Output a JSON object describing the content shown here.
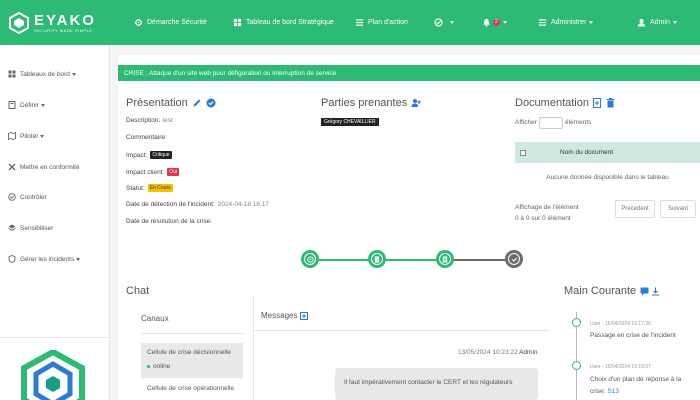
{
  "brand": {
    "name": "EYAKO",
    "tagline": "SECURITY MADE SIMPLE",
    "accent": "#2dba74"
  },
  "topnav": {
    "items": [
      {
        "id": "demarche",
        "label": "Démarche Sécurité",
        "icon": "gear-icon"
      },
      {
        "id": "tableau",
        "label": "Tableau de bord Stratégique",
        "icon": "grid-icon"
      },
      {
        "id": "plan",
        "label": "Plan d'action",
        "icon": "list-icon"
      }
    ],
    "check_icon": "check-circle-icon",
    "notifications_count": "2",
    "admin_menu": "Administrer",
    "user_menu": "Admin"
  },
  "sidebar": {
    "items": [
      {
        "label": "Tableaux de bord",
        "icon": "dashboard-icon",
        "dropdown": true
      },
      {
        "label": "Définir",
        "icon": "book-icon",
        "dropdown": true
      },
      {
        "label": "Piloter",
        "icon": "map-icon",
        "dropdown": true
      },
      {
        "label": "Mettre en conformité",
        "icon": "tools-icon",
        "dropdown": false
      },
      {
        "label": "Contrôler",
        "icon": "check-circle-icon",
        "dropdown": false
      },
      {
        "label": "Sensibiliser",
        "icon": "layers-icon",
        "dropdown": false
      },
      {
        "label": "Gérer les incidents",
        "icon": "shield-icon",
        "dropdown": true
      }
    ]
  },
  "crisis": {
    "banner": "CRISE : Attaque d'un site web pour défiguration ou interruption de service"
  },
  "presentation": {
    "title": "Présentation",
    "description_label": "Description:",
    "description_value": "test",
    "commentaire_label": "Commentaire:",
    "impact_label": "Impact:",
    "impact_value": "Critique",
    "impact_client_label": "Impact client:",
    "impact_client_value": "Oui",
    "statut_label": "Statut:",
    "statut_value": "En Cours",
    "detection_label": "Date de détection de l'incident:",
    "detection_value": "2024-04-18 16:17",
    "resolution_label": "Date de résolution de la crise:"
  },
  "stakeholders": {
    "title": "Parties prenantes",
    "person": "Grégory CHEVAILLIER"
  },
  "documentation": {
    "title": "Documentation",
    "show_label": "Afficher",
    "elements_label": "éléments",
    "column_name": "Nom du document",
    "empty_text": "Aucune donnée disponible dans le tableau",
    "info_line1": "Affichage de l'élément",
    "info_line2": "0 à 0 sur 0 élément",
    "prev_label": "Precedent",
    "next_label": "Suivant"
  },
  "stepper": {
    "steps": [
      {
        "state": "done",
        "icon": "target-icon"
      },
      {
        "state": "done",
        "icon": "door-icon"
      },
      {
        "state": "done",
        "icon": "document-icon"
      },
      {
        "state": "current",
        "icon": "check-icon"
      }
    ]
  },
  "chat": {
    "title": "Chat",
    "channels_title": "Canaux",
    "channels": [
      {
        "name": "Cellule de crise décisionnelle",
        "status": "online",
        "active": true
      },
      {
        "name": "Cellule de crise opérationnelle",
        "status": "",
        "active": false
      }
    ],
    "messages_title": "Messages",
    "message": {
      "timestamp": "13/05/2024 10:23:22",
      "author": "Admin",
      "text": "Il faut impérativement contacter le CERT et les régulateurs"
    }
  },
  "main_courante": {
    "title": "Main Courante",
    "entries": [
      {
        "meta": "User - 16/04/2024 16:17:26",
        "text": "Passage en crise de l'incident",
        "link": ""
      },
      {
        "meta": "User - 16/04/2024 16:19:57",
        "text": "Choix d'un plan de réponse à la",
        "text2": "crise:",
        "link": "S13"
      }
    ]
  }
}
